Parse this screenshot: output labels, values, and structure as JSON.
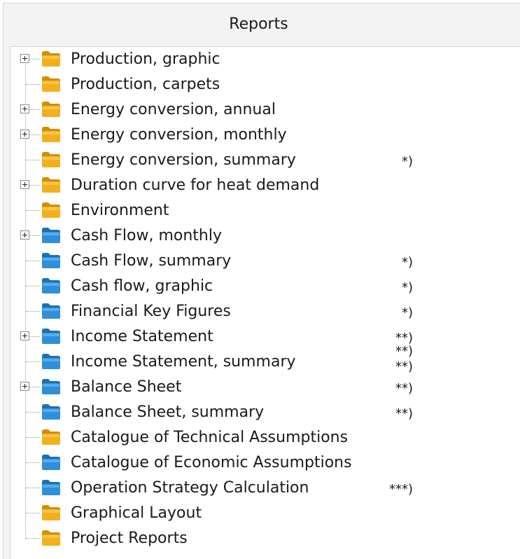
{
  "panel": {
    "title": "Reports"
  },
  "colors": {
    "folder_yellow": "#f2b01e",
    "folder_blue": "#2f8fd8",
    "panel_background": "#f3f3f3",
    "tree_background": "#ffffff"
  },
  "tree": {
    "items": [
      {
        "label": "Production, graphic",
        "icon": "folder-yellow-icon",
        "expandable": true,
        "note": ""
      },
      {
        "label": "Production, carpets",
        "icon": "folder-yellow-icon",
        "expandable": false,
        "note": ""
      },
      {
        "label": "Energy conversion, annual",
        "icon": "folder-yellow-icon",
        "expandable": true,
        "note": ""
      },
      {
        "label": "Energy conversion, monthly",
        "icon": "folder-yellow-icon",
        "expandable": true,
        "note": ""
      },
      {
        "label": "Energy conversion, summary",
        "icon": "folder-yellow-icon",
        "expandable": false,
        "note": "*)"
      },
      {
        "label": "Duration curve for heat demand",
        "icon": "folder-yellow-icon",
        "expandable": true,
        "note": ""
      },
      {
        "label": "Environment",
        "icon": "folder-yellow-icon",
        "expandable": false,
        "note": ""
      },
      {
        "label": "Cash Flow, monthly",
        "icon": "folder-blue-icon",
        "expandable": true,
        "note": ""
      },
      {
        "label": "Cash Flow, summary",
        "icon": "folder-blue-icon",
        "expandable": false,
        "note": "*)"
      },
      {
        "label": "Cash flow, graphic",
        "icon": "folder-blue-icon",
        "expandable": false,
        "note": "*)"
      },
      {
        "label": "Financial Key Figures",
        "icon": "folder-blue-icon",
        "expandable": false,
        "note": "*)"
      },
      {
        "label": "Income Statement",
        "icon": "folder-blue-icon",
        "expandable": true,
        "note": "**)"
      },
      {
        "label": "Income Statement, summary",
        "icon": "folder-blue-icon",
        "expandable": false,
        "note": "**)\n**)"
      },
      {
        "label": "Balance Sheet",
        "icon": "folder-blue-icon",
        "expandable": true,
        "note": "**)"
      },
      {
        "label": "Balance Sheet, summary",
        "icon": "folder-blue-icon",
        "expandable": false,
        "note": "**)"
      },
      {
        "label": "Catalogue of Technical Assumptions",
        "icon": "folder-yellow-icon",
        "expandable": false,
        "note": ""
      },
      {
        "label": "Catalogue of Economic Assumptions",
        "icon": "folder-blue-icon",
        "expandable": false,
        "note": ""
      },
      {
        "label": "Operation Strategy Calculation",
        "icon": "folder-blue-icon",
        "expandable": false,
        "note": "***)"
      },
      {
        "label": "Graphical Layout",
        "icon": "folder-yellow-icon",
        "expandable": false,
        "note": ""
      },
      {
        "label": "Project Reports",
        "icon": "folder-yellow-icon",
        "expandable": false,
        "note": ""
      }
    ]
  }
}
